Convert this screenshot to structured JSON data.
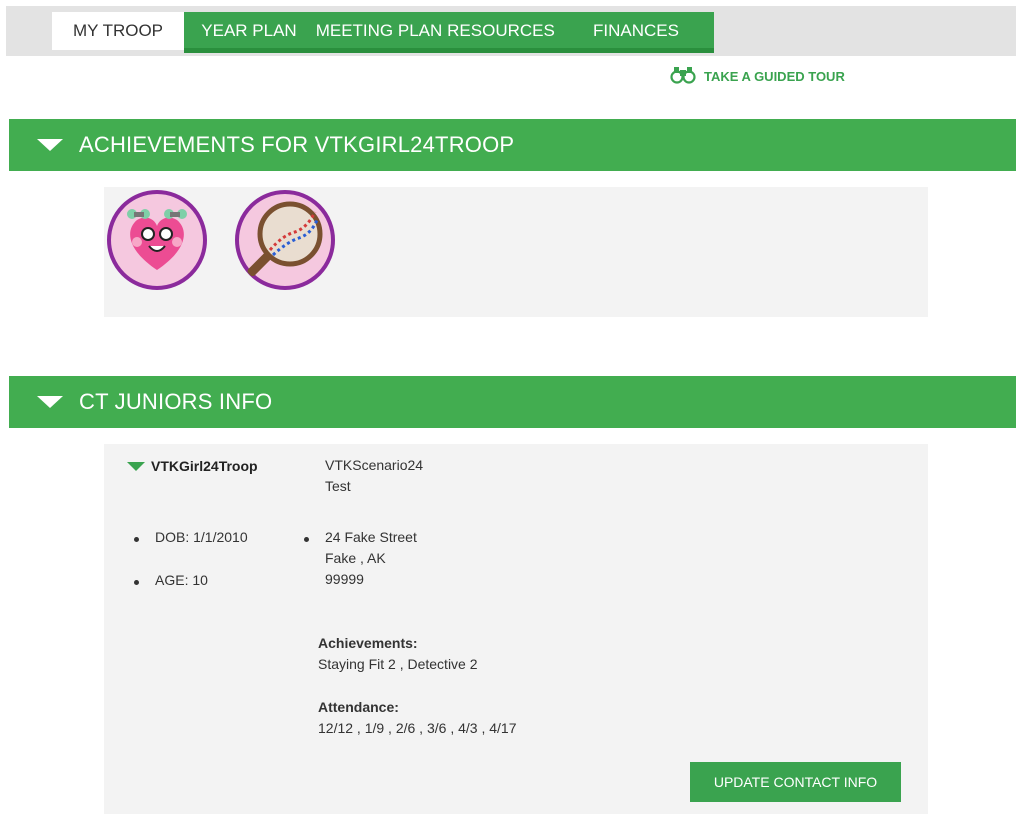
{
  "nav": {
    "tabs": [
      {
        "label": "MY TROOP",
        "active": true
      },
      {
        "label": "YEAR PLAN",
        "active": false
      },
      {
        "label": "MEETING PLAN",
        "active": false
      },
      {
        "label": "RESOURCES",
        "active": false
      },
      {
        "label": "FINANCES",
        "active": false
      }
    ],
    "tour_label": "TAKE A GUIDED TOUR",
    "tour_icon": "binoculars-icon"
  },
  "achievements_section": {
    "title": "ACHIEVEMENTS FOR VTKGIRL24TROOP",
    "badges": [
      {
        "name": "Staying Fit badge",
        "icon": "heart-badge-icon"
      },
      {
        "name": "Detective badge",
        "icon": "magnifier-dna-badge-icon"
      }
    ]
  },
  "info_section": {
    "title": "CT JUNIORS INFO",
    "member": {
      "name": "VTKGirl24Troop",
      "scenario_line1": "VTKScenario24",
      "scenario_line2": "Test",
      "dob": "DOB: 1/1/2010",
      "age": "AGE: 10",
      "address_line1": "24 Fake Street",
      "address_line2": "Fake , AK",
      "address_line3": "99999",
      "achievements_label": "Achievements:",
      "achievements_value": "Staying Fit 2 , Detective 2",
      "attendance_label": "Attendance:",
      "attendance_value": "12/12 , 1/9 , 2/6 , 3/6 , 4/3 , 4/17"
    },
    "update_button": "UPDATE CONTACT INFO"
  },
  "colors": {
    "brand_green": "#42ad50",
    "panel_bg": "#f3f3f3",
    "badge_border": "#8b2a9c"
  }
}
